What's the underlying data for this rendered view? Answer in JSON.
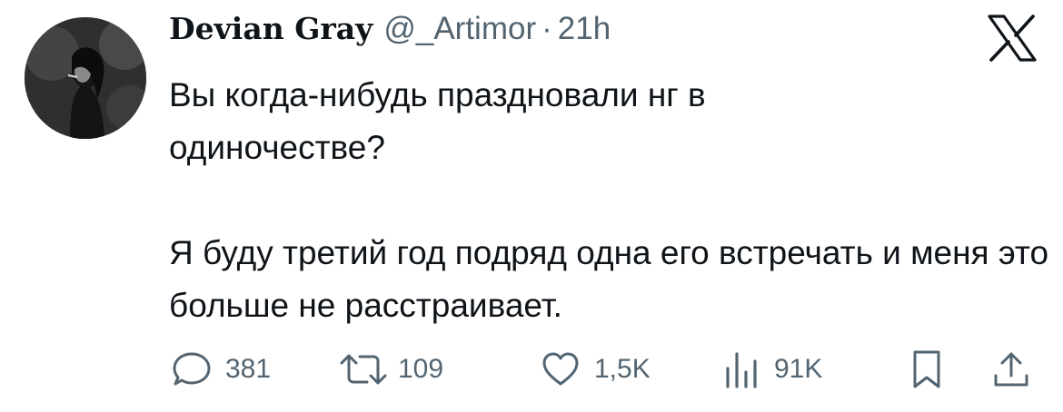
{
  "author": {
    "display_name": "Devian Gray",
    "handle": "@_Artimor",
    "separator": "·",
    "time": "21h"
  },
  "tweet": {
    "paragraphs": [
      "Вы когда-нибудь праздновали нг в одиночестве?",
      "Я буду третий год подряд одна его встречать и меня это больше не расстраивает."
    ]
  },
  "actions": {
    "replies": "381",
    "reposts": "109",
    "likes": "1,5K",
    "views": "91K"
  },
  "icons": {
    "reply": "reply-bubble-icon",
    "repost": "repost-arrows-icon",
    "like": "heart-icon",
    "views": "bar-chart-icon",
    "bookmark": "bookmark-icon",
    "share": "share-upload-icon",
    "brand": "x-logo-icon"
  },
  "colors": {
    "text": "#0f1419",
    "secondary": "#536471",
    "background": "#ffffff"
  }
}
